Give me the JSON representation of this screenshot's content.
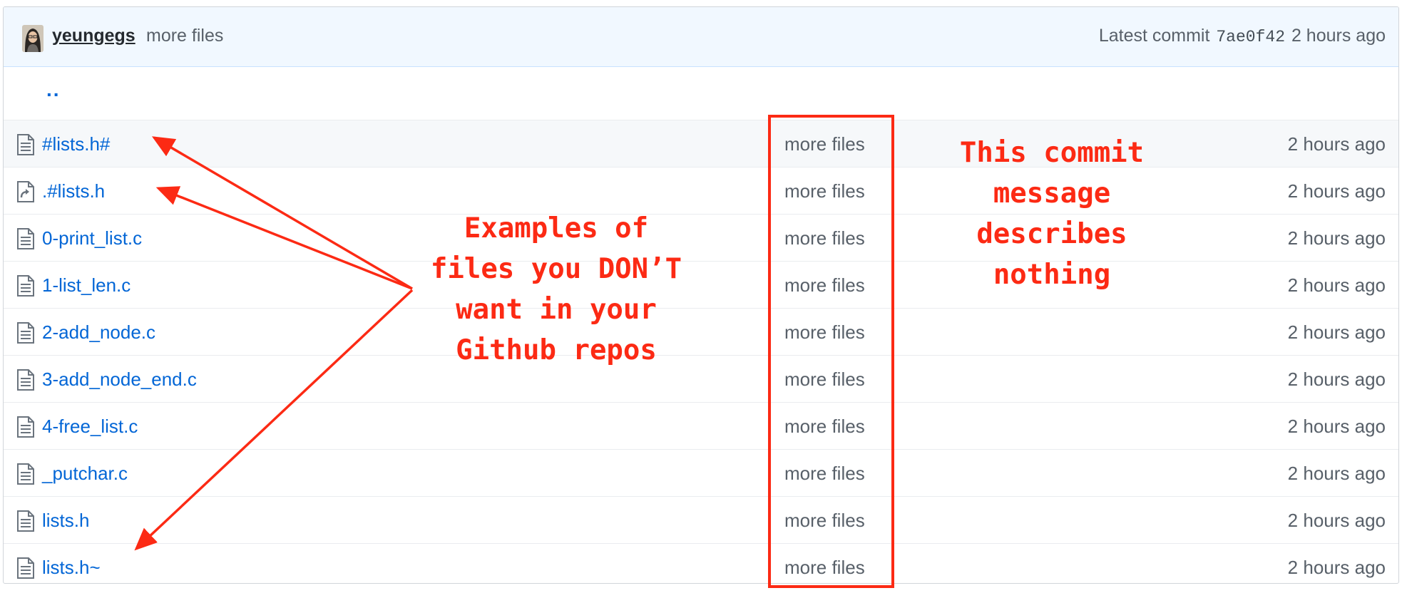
{
  "commit_bar": {
    "author": "yeungegs",
    "message": "more files",
    "latest_label": "Latest commit",
    "sha": "7ae0f42",
    "age": "2 hours ago"
  },
  "parent_link": "..",
  "files": [
    {
      "name": "#lists.h#",
      "type": "file",
      "message": "more files",
      "age": "2 hours ago"
    },
    {
      "name": ".#lists.h",
      "type": "symlink",
      "message": "more files",
      "age": "2 hours ago"
    },
    {
      "name": "0-print_list.c",
      "type": "file",
      "message": "more files",
      "age": "2 hours ago"
    },
    {
      "name": "1-list_len.c",
      "type": "file",
      "message": "more files",
      "age": "2 hours ago"
    },
    {
      "name": "2-add_node.c",
      "type": "file",
      "message": "more files",
      "age": "2 hours ago"
    },
    {
      "name": "3-add_node_end.c",
      "type": "file",
      "message": "more files",
      "age": "2 hours ago"
    },
    {
      "name": "4-free_list.c",
      "type": "file",
      "message": "more files",
      "age": "2 hours ago"
    },
    {
      "name": "_putchar.c",
      "type": "file",
      "message": "more files",
      "age": "2 hours ago"
    },
    {
      "name": "lists.h",
      "type": "file",
      "message": "more files",
      "age": "2 hours ago"
    },
    {
      "name": "lists.h~",
      "type": "file",
      "message": "more files",
      "age": "2 hours ago"
    }
  ],
  "annotations": {
    "left_lines": [
      "Examples of",
      "files you DON’T",
      "want in your",
      "Github repos"
    ],
    "right_lines": [
      "This commit",
      "message",
      "describes",
      "nothing"
    ],
    "color": "#fc2a14"
  },
  "colors": {
    "link": "#0366d6",
    "muted": "#586069",
    "commit_bar_bg": "#f1f8ff",
    "annotation": "#fc2a14"
  },
  "icons": {
    "file": "file-text-icon",
    "symlink": "file-symlink-icon"
  }
}
